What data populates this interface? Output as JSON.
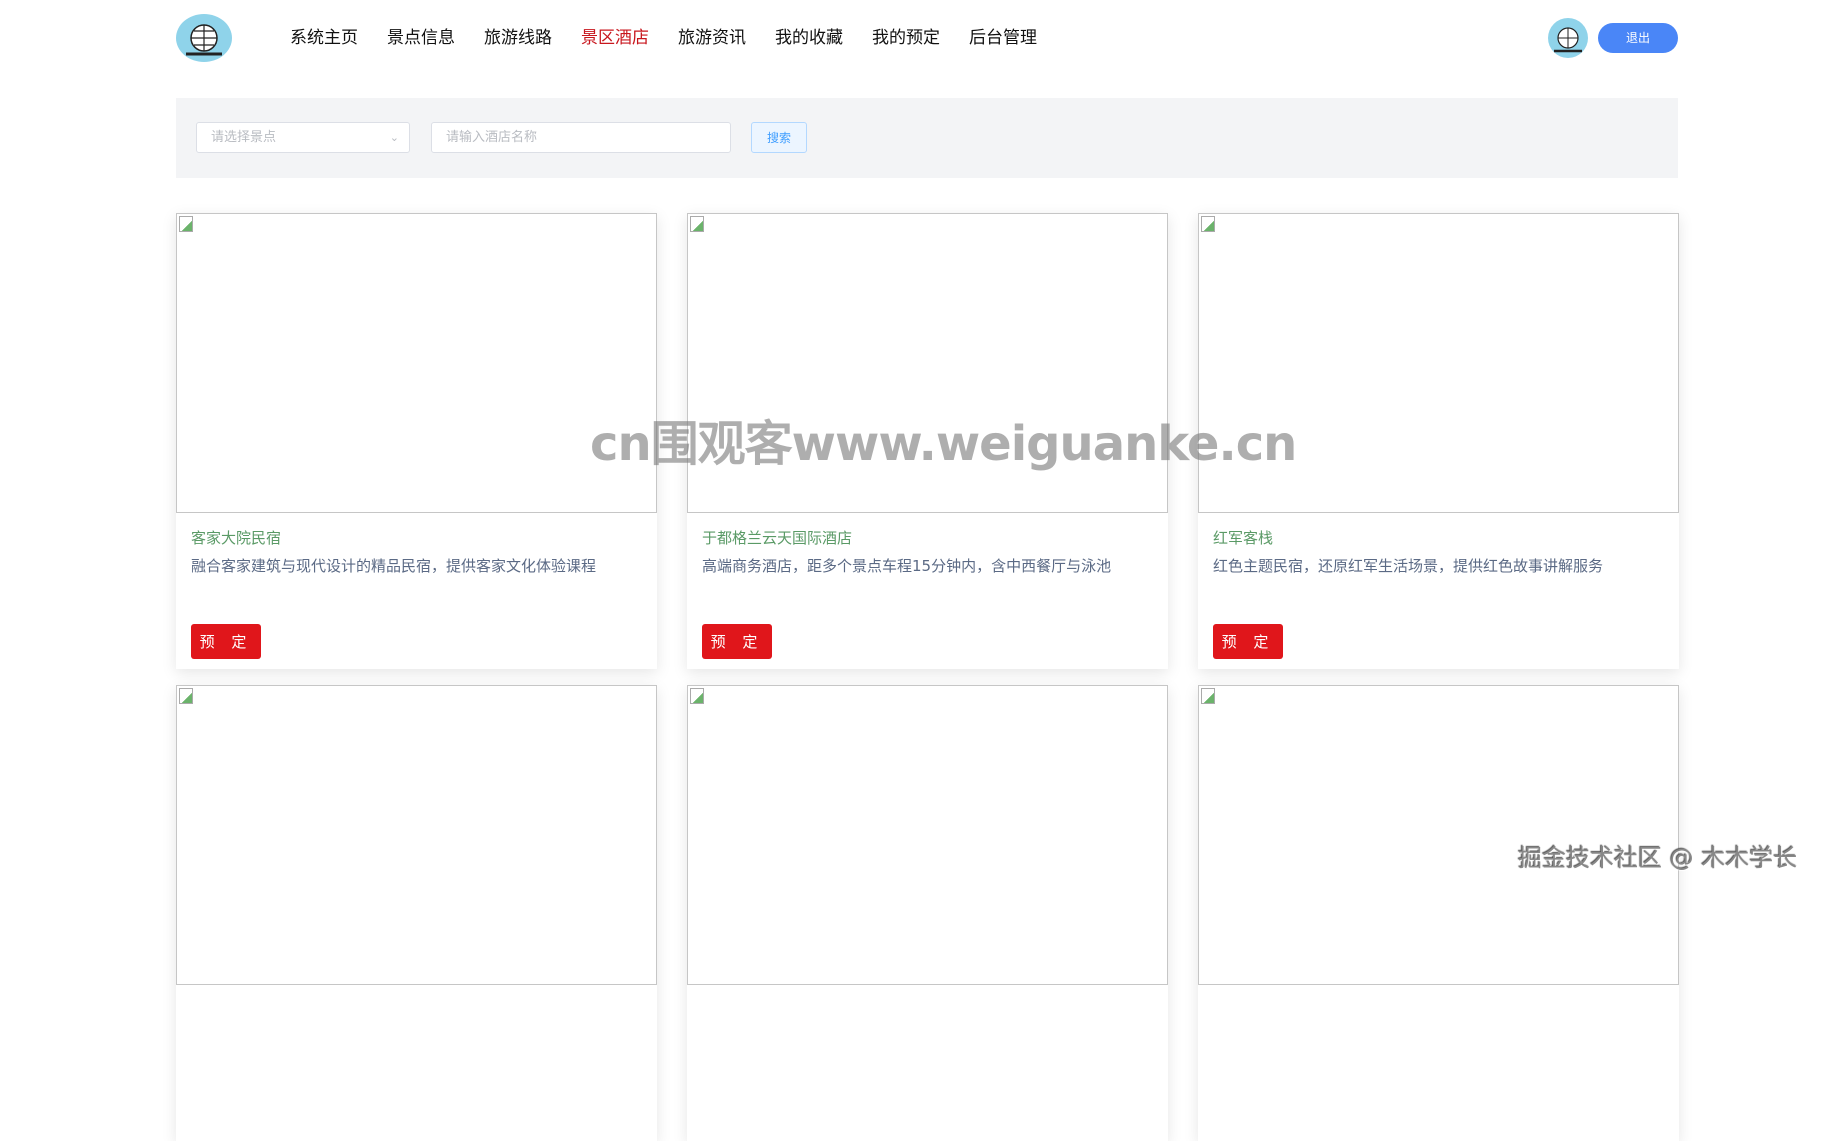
{
  "header": {
    "nav": [
      {
        "label": "系统主页"
      },
      {
        "label": "景点信息"
      },
      {
        "label": "旅游线路"
      },
      {
        "label": "景区酒店",
        "active": true
      },
      {
        "label": "旅游资讯"
      },
      {
        "label": "我的收藏"
      },
      {
        "label": "我的预定"
      },
      {
        "label": "后台管理"
      }
    ],
    "logout_label": "退出",
    "accent_active": "#c8161d"
  },
  "search": {
    "scenic_placeholder": "请选择景点",
    "hotel_placeholder": "请输入酒店名称",
    "search_label": "搜索"
  },
  "hotels": [
    {
      "name": "客家大院民宿",
      "desc": "融合客家建筑与现代设计的精品民宿，提供客家文化体验课程",
      "book_label": "预 定"
    },
    {
      "name": "于都格兰云天国际酒店",
      "desc": "高端商务酒店，距多个景点车程15分钟内，含中西餐厅与泳池",
      "book_label": "预 定"
    },
    {
      "name": "红军客栈",
      "desc": "红色主题民宿，还原红军生活场景，提供红色故事讲解服务",
      "book_label": "预 定"
    },
    {
      "name": "",
      "desc": "",
      "book_label": ""
    },
    {
      "name": "",
      "desc": "",
      "book_label": ""
    },
    {
      "name": "",
      "desc": "",
      "book_label": ""
    }
  ],
  "watermarks": {
    "center": "cn围观客www.weiguanke.cn",
    "corner": "掘金技术社区 @ 木木学长"
  }
}
